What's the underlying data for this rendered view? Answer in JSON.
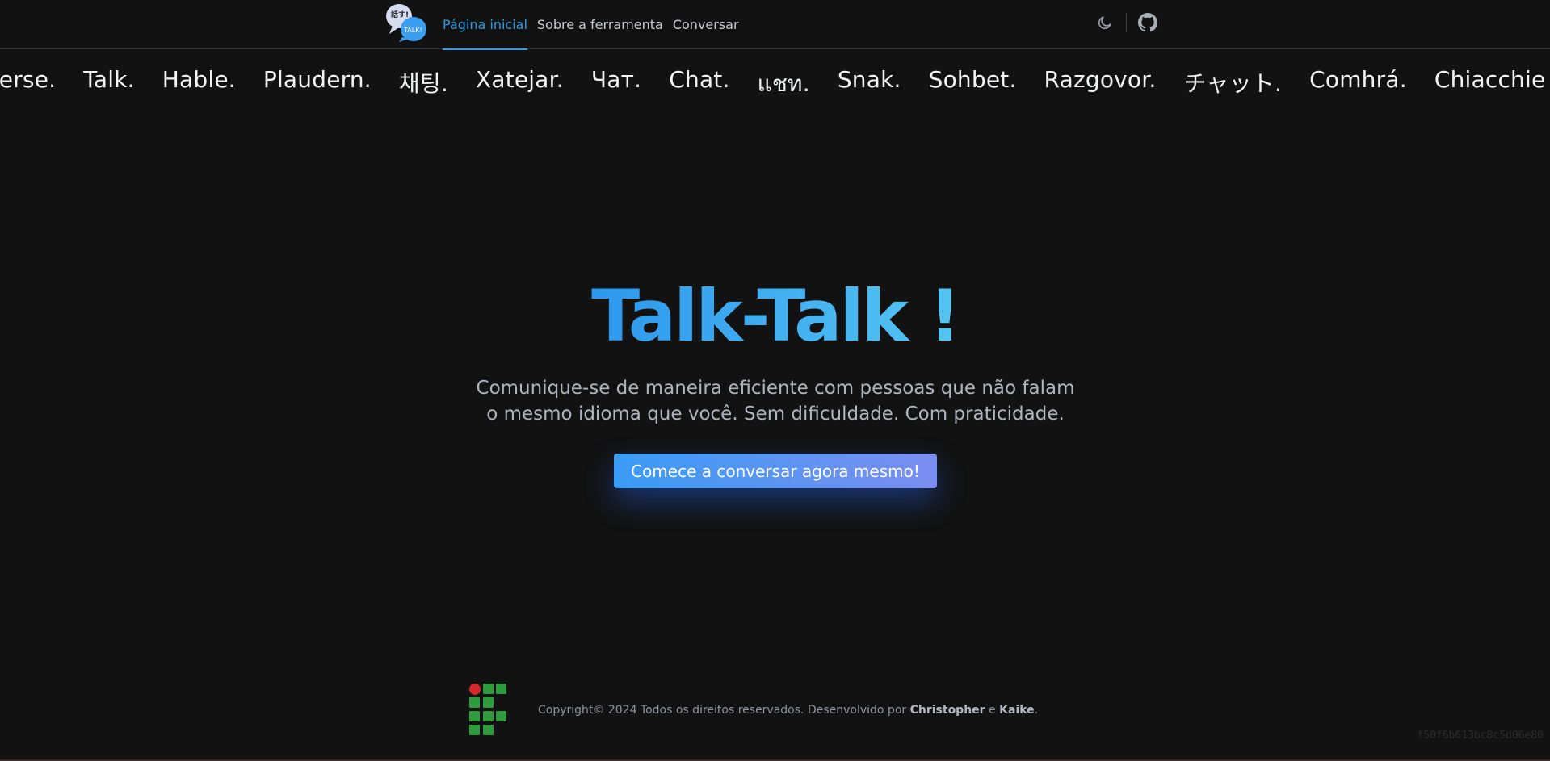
{
  "header": {
    "logo": {
      "icon": "chat-bubbles-logo",
      "text_top": "話す!",
      "text_bottom": "TALK!"
    },
    "nav": [
      {
        "label": "Página inicial",
        "active": true
      },
      {
        "label": "Sobre a ferramenta",
        "active": false
      },
      {
        "label": "Conversar",
        "active": false
      }
    ],
    "theme_toggle_icon": "moon-icon",
    "github_icon": "github-icon"
  },
  "marquee": {
    "words": [
      "verse.",
      "Talk.",
      "Hable.",
      "Plaudern.",
      "채팅.",
      "Xatejar.",
      "Чат.",
      "Chat.",
      "แชท.",
      "Snak.",
      "Sohbet.",
      "Razgovor.",
      "チャット.",
      "Comhrá.",
      "Chiacchie"
    ]
  },
  "hero": {
    "title": "Talk-Talk !",
    "subtitle_line1": "Comunique-se de maneira eficiente com pessoas que não falam",
    "subtitle_line2": "o mesmo idioma que você. Sem dificuldade. Com praticidade.",
    "cta_label": "Comece a conversar agora mesmo!"
  },
  "footer": {
    "logo_icon": "institute-logo",
    "copyright_prefix": "Copyright© 2024 Todos os direitos reservados. Desenvolvido por ",
    "author1": "Christopher",
    "conjunction": " e ",
    "author2": "Kaike",
    "suffix": "."
  },
  "hash": "f50f6b613bc8c5d06e80",
  "colors": {
    "background": "#121212",
    "accent": "#2f9be3",
    "title_gradient_start": "#2d97ee",
    "title_gradient_end": "#55c6f2",
    "button_gradient_start": "#3a9cf5",
    "button_gradient_end": "#7b8ef0",
    "logo_green": "#2e9b3e",
    "logo_red": "#d7262c"
  }
}
